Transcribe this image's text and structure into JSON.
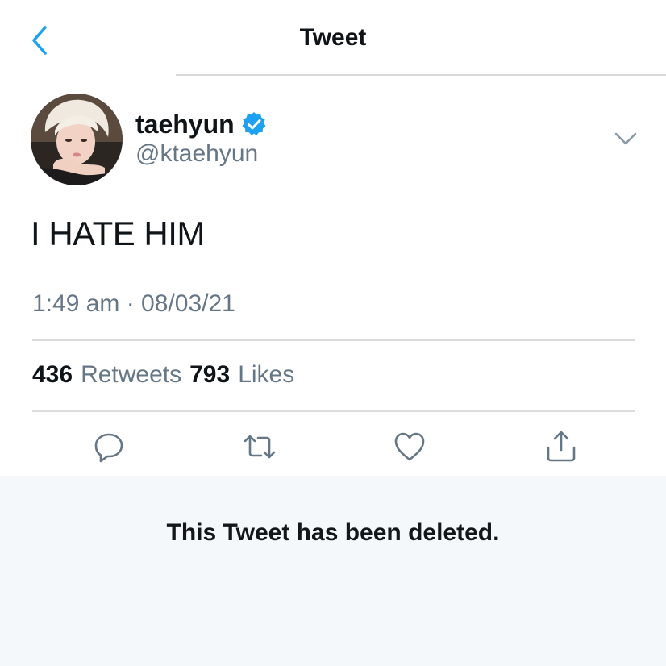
{
  "header": {
    "title": "Tweet",
    "back_icon": "chevron-left-icon"
  },
  "author": {
    "display_name": "taehyun",
    "handle": "@ktaehyun",
    "verified": true,
    "verified_icon": "verified-badge-icon"
  },
  "tweet": {
    "text": "I HATE HIM",
    "timestamp": "1:49 am · 08/03/21"
  },
  "stats": {
    "retweets_count": "436",
    "retweets_label": "Retweets",
    "likes_count": "793",
    "likes_label": "Likes"
  },
  "actions": [
    {
      "icon": "reply-icon"
    },
    {
      "icon": "retweet-icon"
    },
    {
      "icon": "like-heart-icon"
    },
    {
      "icon": "share-icon"
    }
  ],
  "notice": {
    "text": "This Tweet has been deleted."
  },
  "colors": {
    "accent": "#1da1f2",
    "text_primary": "#0f1419",
    "text_secondary": "#657786",
    "panel_background": "#f5f8fa"
  }
}
